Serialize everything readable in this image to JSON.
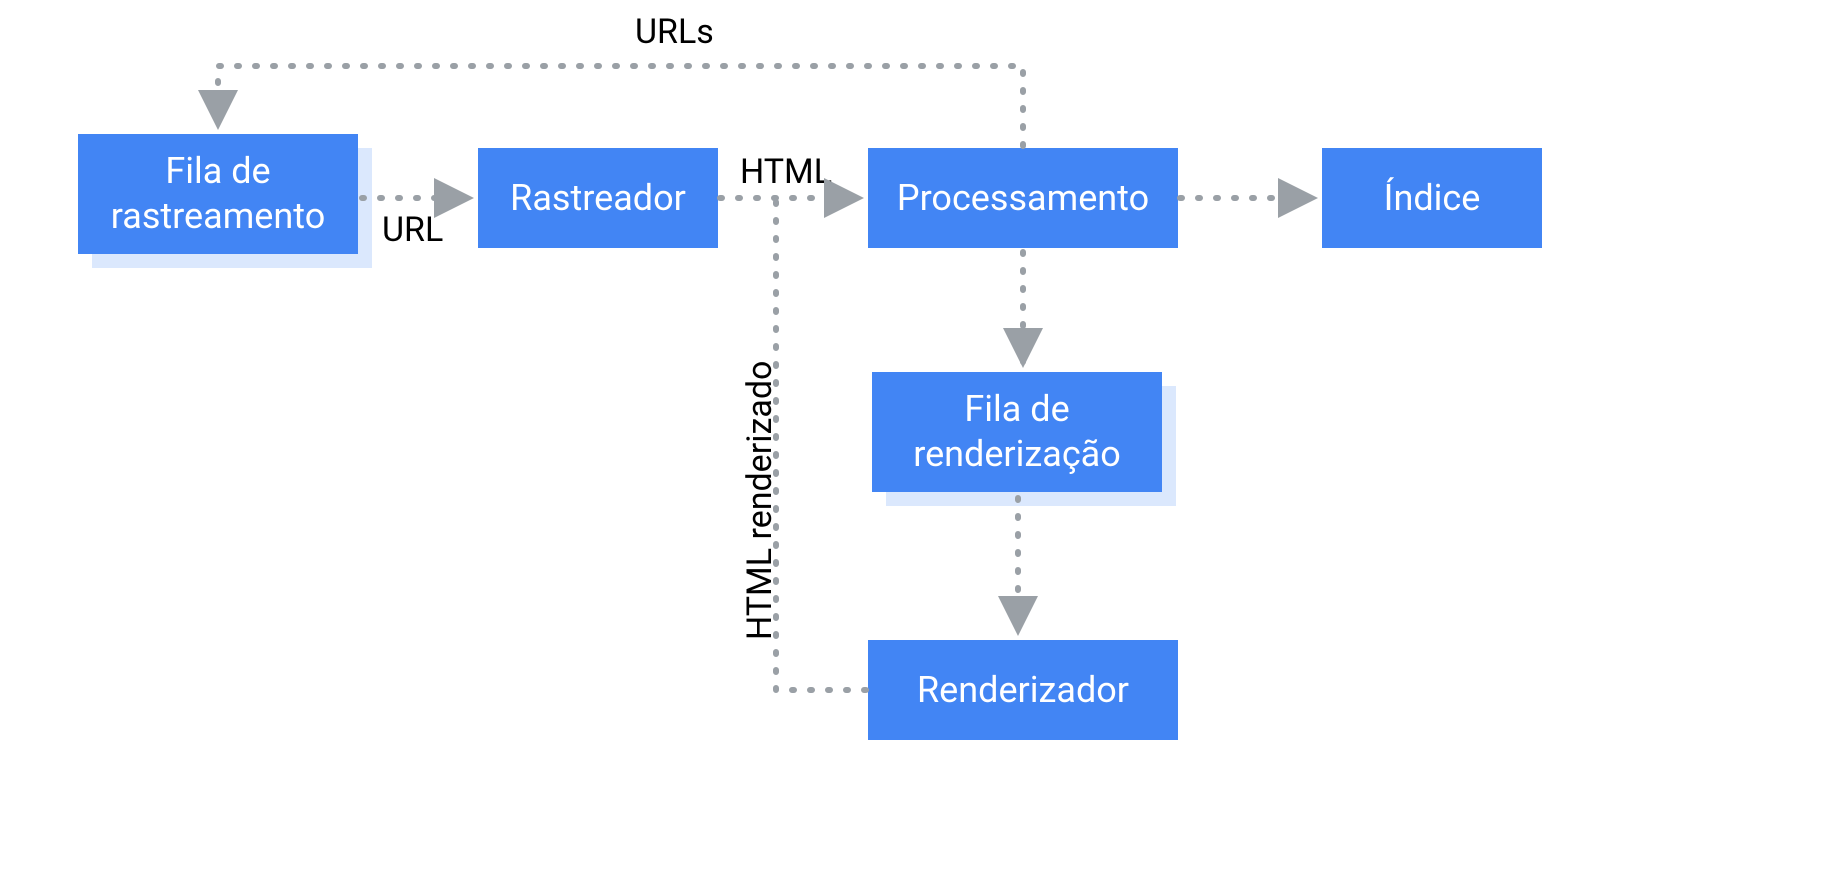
{
  "nodes": {
    "crawl_queue": "Fila de\nrastreamento",
    "crawler": "Rastreador",
    "processing": "Processamento",
    "index": "Índice",
    "render_queue": "Fila de\nrenderização",
    "renderer": "Renderizador"
  },
  "edges": {
    "urls": "URLs",
    "url": "URL",
    "html": "HTML",
    "html_rendered": "HTML renderizado"
  },
  "colors": {
    "box_fill": "#4285f4",
    "box_shadow": "#dbe8fd",
    "box_text": "#ffffff",
    "edge": "#9aa0a6",
    "label": "#000000"
  }
}
